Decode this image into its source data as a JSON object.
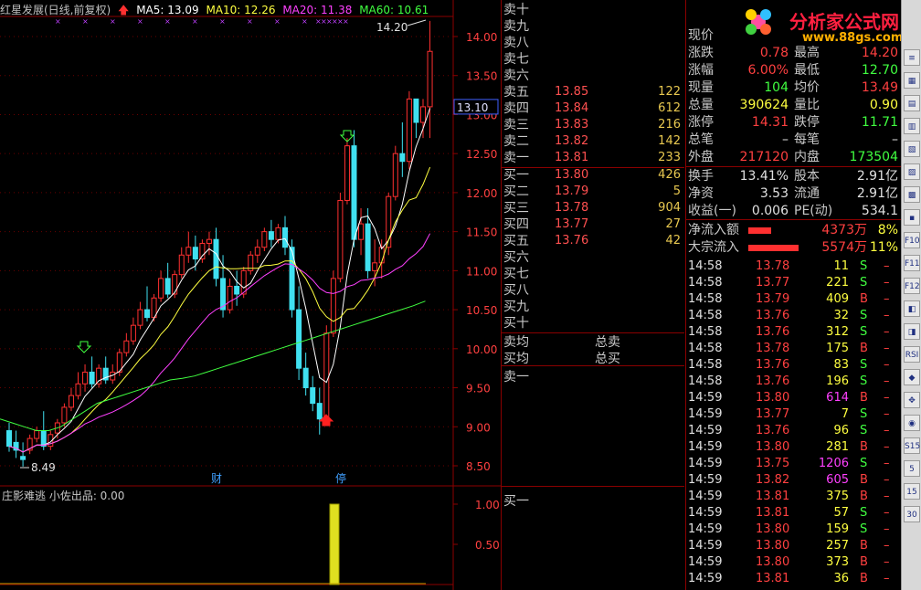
{
  "header": {
    "stock": "红星发展(日线,前复权)",
    "ma5": "MA5: 13.09",
    "ma10": "MA10: 12.26",
    "ma20": "MA20: 11.38",
    "ma60": "MA60: 10.61"
  },
  "chart": {
    "price_axis": [
      "14.00",
      "13.50",
      "13.00",
      "12.50",
      "12.00",
      "11.50",
      "11.00",
      "10.50",
      "10.00",
      "9.50",
      "9.00",
      "8.50"
    ],
    "current_price_tag": "13.10",
    "high_label": "14.20",
    "low_label": "8.49",
    "markers": [
      "财",
      "停"
    ],
    "sub_title": "庄影难逃  小佐出品: 0.00",
    "sub_axis": [
      "1.00",
      "0.50"
    ]
  },
  "order_book": {
    "asks": [
      {
        "label": "卖十",
        "price": "",
        "vol": ""
      },
      {
        "label": "卖九",
        "price": "",
        "vol": ""
      },
      {
        "label": "卖八",
        "price": "",
        "vol": ""
      },
      {
        "label": "卖七",
        "price": "",
        "vol": ""
      },
      {
        "label": "卖六",
        "price": "",
        "vol": ""
      },
      {
        "label": "卖五",
        "price": "13.85",
        "vol": "122"
      },
      {
        "label": "卖四",
        "price": "13.84",
        "vol": "612"
      },
      {
        "label": "卖三",
        "price": "13.83",
        "vol": "216"
      },
      {
        "label": "卖二",
        "price": "13.82",
        "vol": "142"
      },
      {
        "label": "卖一",
        "price": "13.81",
        "vol": "233"
      }
    ],
    "bids": [
      {
        "label": "买一",
        "price": "13.80",
        "vol": "426"
      },
      {
        "label": "买二",
        "price": "13.79",
        "vol": "5"
      },
      {
        "label": "买三",
        "price": "13.78",
        "vol": "904"
      },
      {
        "label": "买四",
        "price": "13.77",
        "vol": "27"
      },
      {
        "label": "买五",
        "price": "13.76",
        "vol": "42"
      },
      {
        "label": "买六",
        "price": "",
        "vol": ""
      },
      {
        "label": "买七",
        "price": "",
        "vol": ""
      },
      {
        "label": "买八",
        "price": "",
        "vol": ""
      },
      {
        "label": "买九",
        "price": "",
        "vol": ""
      },
      {
        "label": "买十",
        "price": "",
        "vol": ""
      }
    ],
    "ask_avg": "卖均",
    "total_ask": "总卖",
    "bid_avg": "买均",
    "total_bid": "总买",
    "ask1_again": "卖一",
    "bid1_again": "买一"
  },
  "info": {
    "rows": [
      {
        "l1": "现价",
        "v1": "",
        "c1": "red",
        "l2": "",
        "v2": "",
        "c2": "red"
      },
      {
        "l1": "涨跌",
        "v1": "0.78",
        "c1": "red",
        "l2": "最高",
        "v2": "14.20",
        "c2": "red"
      },
      {
        "l1": "涨幅",
        "v1": "6.00%",
        "c1": "red",
        "l2": "最低",
        "v2": "12.70",
        "c2": "grn"
      },
      {
        "l1": "现量",
        "v1": "104",
        "c1": "grn",
        "l2": "均价",
        "v2": "13.49",
        "c2": "red"
      },
      {
        "l1": "总量",
        "v1": "390624",
        "c1": "yel",
        "l2": "量比",
        "v2": "0.90",
        "c2": "yel"
      },
      {
        "l1": "涨停",
        "v1": "14.31",
        "c1": "red",
        "l2": "跌停",
        "v2": "11.71",
        "c2": "grn"
      },
      {
        "l1": "总笔",
        "v1": "–",
        "c1": "wht",
        "l2": "每笔",
        "v2": "–",
        "c2": "wht"
      },
      {
        "l1": "外盘",
        "v1": "217120",
        "c1": "red",
        "l2": "内盘",
        "v2": "173504",
        "c2": "grn"
      },
      {
        "l1": "换手",
        "v1": "13.41%",
        "c1": "wht",
        "l2": "股本",
        "v2": "2.91亿",
        "c2": "wht"
      },
      {
        "l1": "净资",
        "v1": "3.53",
        "c1": "wht",
        "l2": "流通",
        "v2": "2.91亿",
        "c2": "wht"
      },
      {
        "l1": "收益(一)",
        "v1": "0.006",
        "c1": "wht",
        "l2": "PE(动)",
        "v2": "534.1",
        "c2": "wht"
      }
    ],
    "net_inflow_label": "净流入额",
    "net_inflow_val": "4373万",
    "net_inflow_pct": "8%",
    "net_inflow_ratio": 0.45,
    "big_inflow_label": "大宗流入",
    "big_inflow_val": "5574万",
    "big_inflow_pct": "11%",
    "big_inflow_ratio": 0.98
  },
  "ticks": [
    {
      "t": "14:58",
      "p": "13.78",
      "pc": "red",
      "v": "11",
      "vc": "yel",
      "s": "S",
      "sc": "grn"
    },
    {
      "t": "14:58",
      "p": "13.77",
      "pc": "red",
      "v": "221",
      "vc": "yel",
      "s": "S",
      "sc": "grn"
    },
    {
      "t": "14:58",
      "p": "13.79",
      "pc": "red",
      "v": "409",
      "vc": "yel",
      "s": "B",
      "sc": "red"
    },
    {
      "t": "14:58",
      "p": "13.76",
      "pc": "red",
      "v": "32",
      "vc": "yel",
      "s": "S",
      "sc": "grn"
    },
    {
      "t": "14:58",
      "p": "13.76",
      "pc": "red",
      "v": "312",
      "vc": "yel",
      "s": "S",
      "sc": "grn"
    },
    {
      "t": "14:58",
      "p": "13.78",
      "pc": "red",
      "v": "175",
      "vc": "yel",
      "s": "B",
      "sc": "red"
    },
    {
      "t": "14:58",
      "p": "13.76",
      "pc": "red",
      "v": "83",
      "vc": "yel",
      "s": "S",
      "sc": "grn"
    },
    {
      "t": "14:58",
      "p": "13.76",
      "pc": "red",
      "v": "196",
      "vc": "yel",
      "s": "S",
      "sc": "grn"
    },
    {
      "t": "14:59",
      "p": "13.80",
      "pc": "red",
      "v": "614",
      "vc": "mag",
      "s": "B",
      "sc": "red"
    },
    {
      "t": "14:59",
      "p": "13.77",
      "pc": "red",
      "v": "7",
      "vc": "yel",
      "s": "S",
      "sc": "grn"
    },
    {
      "t": "14:59",
      "p": "13.76",
      "pc": "red",
      "v": "96",
      "vc": "yel",
      "s": "S",
      "sc": "grn"
    },
    {
      "t": "14:59",
      "p": "13.80",
      "pc": "red",
      "v": "281",
      "vc": "yel",
      "s": "B",
      "sc": "red"
    },
    {
      "t": "14:59",
      "p": "13.75",
      "pc": "red",
      "v": "1206",
      "vc": "mag",
      "s": "S",
      "sc": "grn"
    },
    {
      "t": "14:59",
      "p": "13.82",
      "pc": "red",
      "v": "605",
      "vc": "mag",
      "s": "B",
      "sc": "red"
    },
    {
      "t": "14:59",
      "p": "13.81",
      "pc": "red",
      "v": "375",
      "vc": "yel",
      "s": "B",
      "sc": "red"
    },
    {
      "t": "14:59",
      "p": "13.81",
      "pc": "red",
      "v": "57",
      "vc": "yel",
      "s": "S",
      "sc": "grn"
    },
    {
      "t": "14:59",
      "p": "13.80",
      "pc": "red",
      "v": "159",
      "vc": "yel",
      "s": "S",
      "sc": "grn"
    },
    {
      "t": "14:59",
      "p": "13.80",
      "pc": "red",
      "v": "257",
      "vc": "yel",
      "s": "B",
      "sc": "red"
    },
    {
      "t": "14:59",
      "p": "13.80",
      "pc": "red",
      "v": "373",
      "vc": "yel",
      "s": "B",
      "sc": "red"
    },
    {
      "t": "14:59",
      "p": "13.81",
      "pc": "red",
      "v": "36",
      "vc": "yel",
      "s": "B",
      "sc": "red"
    }
  ],
  "logo": {
    "text": "分析家公式网",
    "url": "www.88gs.com"
  },
  "toolbar": [
    "≡",
    "▦",
    "▤",
    "▥",
    "▧",
    "▨",
    "▩",
    "▪",
    "F10",
    "F11",
    "F12",
    "◧",
    "◨",
    "RSI",
    "◆",
    "✥",
    "◉",
    "S15",
    "5",
    "15",
    "30"
  ],
  "colors": {
    "up": "#ff3030",
    "down": "#40e0f0",
    "ma5": "#ffffff",
    "ma10": "#ffff40",
    "ma20": "#ff40ff",
    "ma60": "#40ff40",
    "grid": "#8b0000"
  }
}
